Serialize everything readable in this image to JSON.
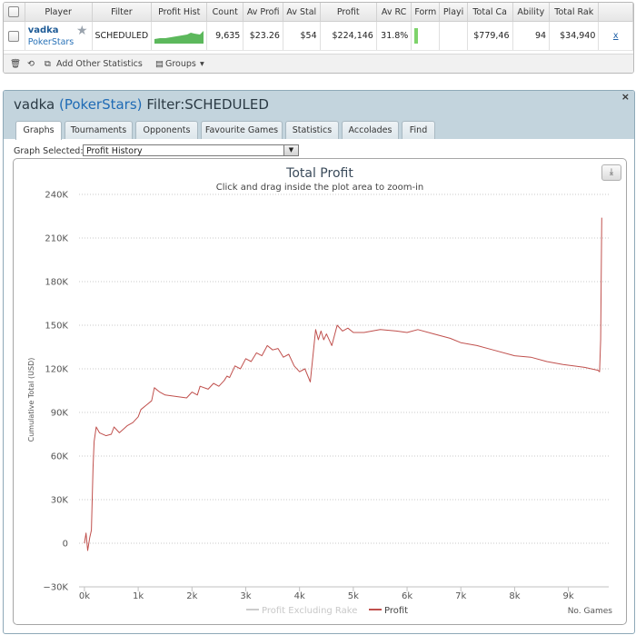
{
  "stats": {
    "headers": {
      "player": "Player",
      "filter": "Filter",
      "profit_hist": "Profit Hist",
      "count": "Count",
      "av_profit": "Av Profi",
      "av_stake": "Av Stal",
      "profit": "Profit",
      "av_roi": "Av RC",
      "form": "Form",
      "playing": "Playi",
      "total_cashes": "Total Ca",
      "ability": "Ability",
      "total_rake": "Total Rak"
    },
    "row": {
      "player_name": "vadka",
      "site": "PokerStars",
      "filter": "SCHEDULED",
      "count": "9,635",
      "av_profit": "$23.26",
      "av_stake": "$54",
      "profit": "$224,146",
      "av_roi": "31.8%",
      "playing": "",
      "total_cashes": "$779,46",
      "ability": "94",
      "total_rake": "$34,940",
      "remove": "x"
    },
    "footer": {
      "add_stats": "Add Other Statistics",
      "groups": "Groups"
    }
  },
  "panel": {
    "title_player": "vadka",
    "title_site": "(PokerStars)",
    "title_filter": "Filter:SCHEDULED",
    "close": "×",
    "tabs": [
      "Graphs",
      "Tournaments",
      "Opponents",
      "Favourite Games",
      "Statistics",
      "Accolades",
      "Find"
    ],
    "graph_select_label": "Graph Selected:",
    "graph_select_value": "Profit History"
  },
  "colors": {
    "profit_line": "#c0504d",
    "no_rake_line": "#cccccc",
    "spark": "#5cb85c",
    "header_bg": "#c3d4dd"
  },
  "chart_data": {
    "type": "line",
    "title": "Total Profit",
    "subtitle": "Click and drag inside the plot area to zoom-in",
    "ylabel": "Cumulative Total (USD)",
    "xlabel": "No. Games",
    "ylim": [
      -30000,
      240000
    ],
    "xlim": [
      -100,
      9750
    ],
    "y_ticks": [
      -30000,
      0,
      30000,
      60000,
      90000,
      120000,
      150000,
      180000,
      210000,
      240000
    ],
    "y_tick_labels": [
      "−30K",
      "0",
      "30K",
      "60K",
      "90K",
      "120K",
      "150K",
      "180K",
      "210K",
      "240K"
    ],
    "x_ticks": [
      0,
      1000,
      2000,
      3000,
      4000,
      5000,
      6000,
      7000,
      8000,
      9000
    ],
    "x_tick_labels": [
      "0k",
      "1k",
      "2k",
      "3k",
      "4k",
      "5k",
      "6k",
      "7k",
      "8k",
      "9k"
    ],
    "legend": [
      "Profit Excluding Rake",
      "Profit"
    ],
    "legend_position": "bottom-center",
    "grid": true,
    "series": [
      {
        "name": "Profit",
        "x": [
          0,
          30,
          60,
          100,
          130,
          160,
          180,
          220,
          280,
          400,
          500,
          550,
          650,
          800,
          900,
          1000,
          1050,
          1150,
          1250,
          1300,
          1400,
          1500,
          1700,
          1900,
          2000,
          2100,
          2150,
          2300,
          2400,
          2500,
          2600,
          2650,
          2700,
          2800,
          2900,
          3000,
          3100,
          3200,
          3300,
          3400,
          3500,
          3600,
          3700,
          3800,
          3900,
          4000,
          4100,
          4200,
          4300,
          4350,
          4400,
          4450,
          4500,
          4600,
          4700,
          4800,
          4900,
          5000,
          5200,
          5500,
          5800,
          6000,
          6200,
          6500,
          6800,
          7000,
          7300,
          7600,
          8000,
          8300,
          8600,
          8900,
          9300,
          9550,
          9580,
          9600,
          9620
        ],
        "y": [
          0,
          7000,
          -5000,
          4000,
          9000,
          52000,
          70000,
          80000,
          76000,
          74000,
          75000,
          80000,
          76000,
          81000,
          83000,
          87000,
          92000,
          95000,
          98000,
          107000,
          104000,
          102000,
          101000,
          100000,
          104000,
          102000,
          108000,
          106000,
          110000,
          108000,
          112000,
          115000,
          114000,
          122000,
          120000,
          127000,
          125000,
          131000,
          129000,
          136000,
          133000,
          134000,
          128000,
          130000,
          122000,
          118000,
          120000,
          111000,
          147000,
          140000,
          146000,
          140000,
          144000,
          136000,
          150000,
          146000,
          148000,
          145000,
          145000,
          147000,
          146000,
          145000,
          147000,
          144000,
          141000,
          138000,
          136000,
          133000,
          129000,
          128000,
          125000,
          123000,
          121000,
          119000,
          118000,
          140000,
          224000
        ]
      }
    ]
  }
}
